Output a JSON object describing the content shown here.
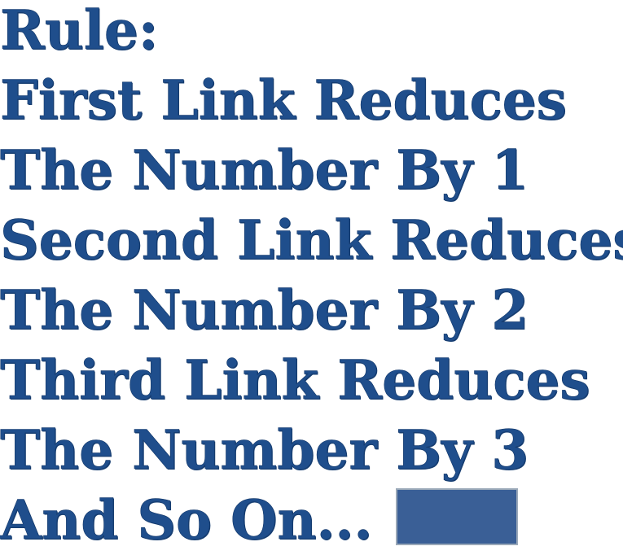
{
  "lines": [
    "Rule:",
    "First Link Reduces",
    "The Number By 1",
    "Second Link Reduces",
    "The Number By 2",
    "Third Link Reduces",
    "The Number By 3",
    "And So On..."
  ],
  "colors": {
    "text": "#1f4e8c",
    "button": "#3a5f96",
    "button_border": "#9aa8b8",
    "background": "#ffffff"
  }
}
